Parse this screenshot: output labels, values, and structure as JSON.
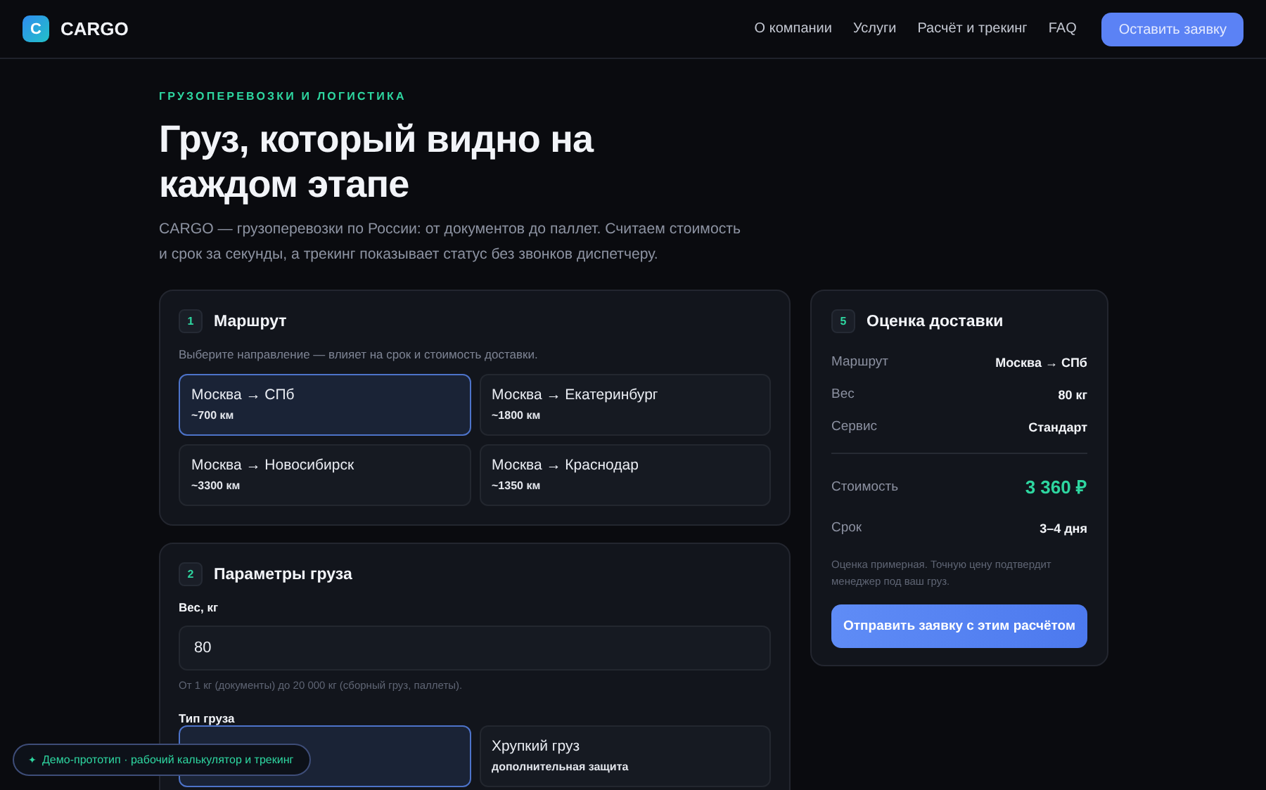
{
  "header": {
    "logo_letter": "C",
    "brand": "CARGO",
    "nav": [
      {
        "label": "О компании"
      },
      {
        "label": "Услуги"
      },
      {
        "label": "Расчёт и трекинг"
      },
      {
        "label": "FAQ"
      }
    ],
    "cta": "Оставить заявку"
  },
  "hero": {
    "eyebrow": "ГРУЗОПЕРЕВОЗКИ И ЛОГИСТИКА",
    "title": "Груз, который видно на каждом этапе",
    "lead": "CARGO — грузоперевозки по России: от документов до паллет. Считаем стоимость и срок за секунды, а трекинг показывает статус без звонков диспетчеру."
  },
  "route": {
    "step": "1",
    "title": "Маршрут",
    "hint": "Выберите направление — влияет на срок и стоимость доставки.",
    "options": [
      {
        "name": "Москва → СПб",
        "distance": "~700 км",
        "selected": true
      },
      {
        "name": "Москва → Екатеринбург",
        "distance": "~1800 км",
        "selected": false
      },
      {
        "name": "Москва → Новосибирск",
        "distance": "~3300 км",
        "selected": false
      },
      {
        "name": "Москва → Краснодар",
        "distance": "~1350 км",
        "selected": false
      }
    ]
  },
  "cargo": {
    "step": "2",
    "title": "Параметры груза",
    "weight_label": "Вес, кг",
    "weight_value": "80",
    "weight_hint": "От 1 кг (документы) до 20 000 кг (сборный груз, паллеты).",
    "type_label": "Тип груза",
    "types": [
      {
        "selected": true
      },
      {
        "name": "Хрупкий груз",
        "note": "дополнительная защита",
        "selected": false
      }
    ]
  },
  "summary": {
    "step": "5",
    "title": "Оценка доставки",
    "rows": [
      {
        "label": "Маршрут",
        "value": "Москва → СПб"
      },
      {
        "label": "Вес",
        "value": "80 кг"
      },
      {
        "label": "Сервис",
        "value": "Стандарт"
      }
    ],
    "cost_label": "Стоимость",
    "cost": "3 360 ₽",
    "term_label": "Срок",
    "term": "3–4 дня",
    "note": "Оценка примерная. Точную цену подтвердит менеджер под ваш груз.",
    "button": "Отправить заявку с этим расчётом"
  },
  "demo_badge": {
    "icon": "✦",
    "text": "Демо-прототип · рабочий калькулятор и трекинг"
  }
}
